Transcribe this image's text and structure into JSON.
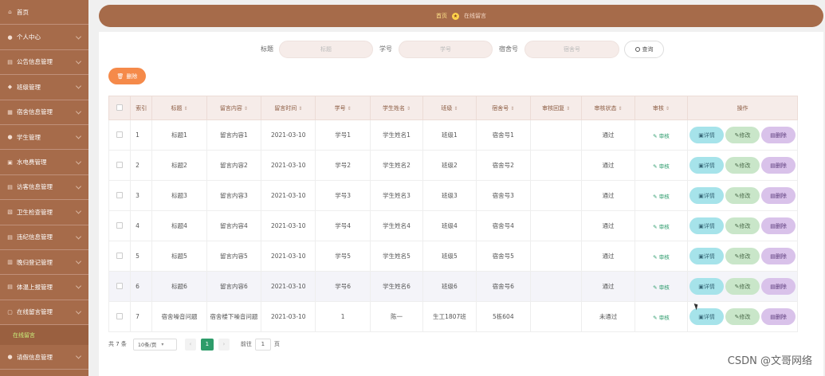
{
  "sidebar": {
    "items": [
      {
        "label": "首页",
        "icon": "home-icon",
        "arrow": false
      },
      {
        "label": "个人中心",
        "icon": "user-icon",
        "arrow": true
      },
      {
        "label": "公告信息管理",
        "icon": "notice-icon",
        "arrow": true
      },
      {
        "label": "班级管理",
        "icon": "class-icon",
        "arrow": true
      },
      {
        "label": "宿舍信息管理",
        "icon": "dorm-icon",
        "arrow": true
      },
      {
        "label": "学生管理",
        "icon": "student-icon",
        "arrow": true
      },
      {
        "label": "水电费管理",
        "icon": "bill-icon",
        "arrow": true
      },
      {
        "label": "访客信息管理",
        "icon": "visitor-icon",
        "arrow": true
      },
      {
        "label": "卫生检查管理",
        "icon": "check-icon",
        "arrow": true
      },
      {
        "label": "违纪信息管理",
        "icon": "violation-icon",
        "arrow": true
      },
      {
        "label": "晚归登记管理",
        "icon": "late-icon",
        "arrow": true
      },
      {
        "label": "体温上报管理",
        "icon": "temp-icon",
        "arrow": true
      },
      {
        "label": "在线留言管理",
        "icon": "message-icon",
        "arrow": true
      }
    ],
    "sub_item": "在线留言",
    "last_item": {
      "label": "请假信息管理",
      "icon": "leave-icon"
    }
  },
  "breadcrumb": {
    "home": "首页",
    "current": "在线留言"
  },
  "search": {
    "title_label": "标题",
    "title_placeholder": "标题",
    "sno_label": "学号",
    "sno_placeholder": "学号",
    "dorm_label": "宿舍号",
    "dorm_placeholder": "宿舍号",
    "button": "查询"
  },
  "actions": {
    "delete_label": "删除"
  },
  "table": {
    "headers": [
      "索引",
      "标题",
      "留言内容",
      "留言时间",
      "学号",
      "学生姓名",
      "班级",
      "宿舍号",
      "审核回复",
      "审核状态",
      "审核",
      "操作"
    ],
    "audit_link": "审核",
    "btn_detail": "详情",
    "btn_edit": "修改",
    "btn_delete": "删除",
    "rows": [
      [
        "1",
        "标题1",
        "留言内容1",
        "2021-03-10",
        "学号1",
        "学生姓名1",
        "班级1",
        "宿舍号1",
        "",
        "通过"
      ],
      [
        "2",
        "标题2",
        "留言内容2",
        "2021-03-10",
        "学号2",
        "学生姓名2",
        "班级2",
        "宿舍号2",
        "",
        "通过"
      ],
      [
        "3",
        "标题3",
        "留言内容3",
        "2021-03-10",
        "学号3",
        "学生姓名3",
        "班级3",
        "宿舍号3",
        "",
        "通过"
      ],
      [
        "4",
        "标题4",
        "留言内容4",
        "2021-03-10",
        "学号4",
        "学生姓名4",
        "班级4",
        "宿舍号4",
        "",
        "通过"
      ],
      [
        "5",
        "标题5",
        "留言内容5",
        "2021-03-10",
        "学号5",
        "学生姓名5",
        "班级5",
        "宿舍号5",
        "",
        "通过"
      ],
      [
        "6",
        "标题6",
        "留言内容6",
        "2021-03-10",
        "学号6",
        "学生姓名6",
        "班级6",
        "宿舍号6",
        "",
        "通过"
      ],
      [
        "7",
        "宿舍噪音问题",
        "宿舍楼下噪音问题",
        "2021-03-10",
        "1",
        "陈一",
        "生工1807班",
        "5栋604",
        "",
        "未通过"
      ]
    ]
  },
  "pagination": {
    "total": "共 7 条",
    "page_size": "10条/页",
    "current_page": "1",
    "goto_label": "前往",
    "goto_value": "1",
    "goto_unit": "页"
  },
  "watermark": "CSDN @文哥网络"
}
